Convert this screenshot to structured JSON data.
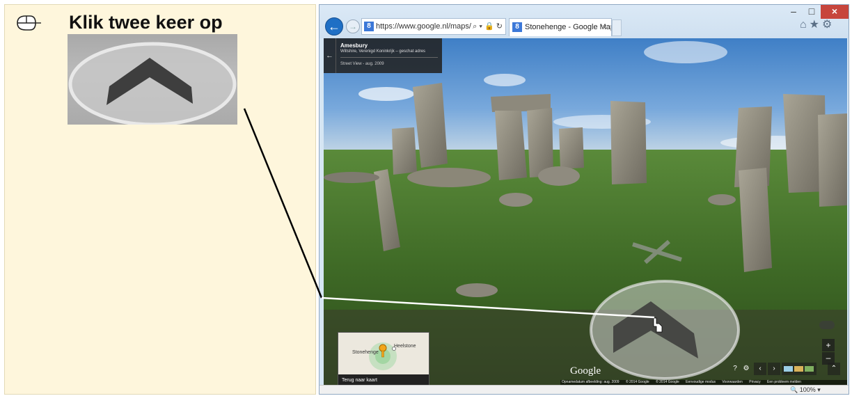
{
  "instruction": {
    "title": "Klik twee keer op",
    "icon": "mouse-icon"
  },
  "browser": {
    "address_url": "https://www.google.nl/maps/@",
    "tab_title": "Stonehenge - Google Maps",
    "tab_close": "×",
    "window_controls": {
      "minimize": "–",
      "maximize": "□",
      "close": "×"
    },
    "nav_icons": "⌂★⚙",
    "addr_tools": "⌕ ▾ 🔒 ↻",
    "status_zoom": "🔍 100%  ▾"
  },
  "streetview": {
    "info": {
      "title": "Amesbury",
      "subtitle": "Wiltshire, Verenigd Koninkrijk – geschat adres",
      "date": "Street View - aug. 2009"
    },
    "minimap": {
      "label_stonehenge": "Stonehenge",
      "label_heelstone": "Heelstone",
      "footer": "Terug naar kaart"
    },
    "logo": "Google",
    "footer_items": [
      "Opnamedatum afbeelding: aug. 2009",
      "© 2014 Google",
      "© 2014 Google",
      "Eenvoudige modus",
      "Voorwaarden",
      "Privacy",
      "Een probleem melden"
    ],
    "controls": {
      "zoom_in": "+",
      "zoom_out": "–",
      "help": "?",
      "settings": "⚙",
      "prev": "‹",
      "next": "›",
      "expand": "⌃"
    }
  }
}
